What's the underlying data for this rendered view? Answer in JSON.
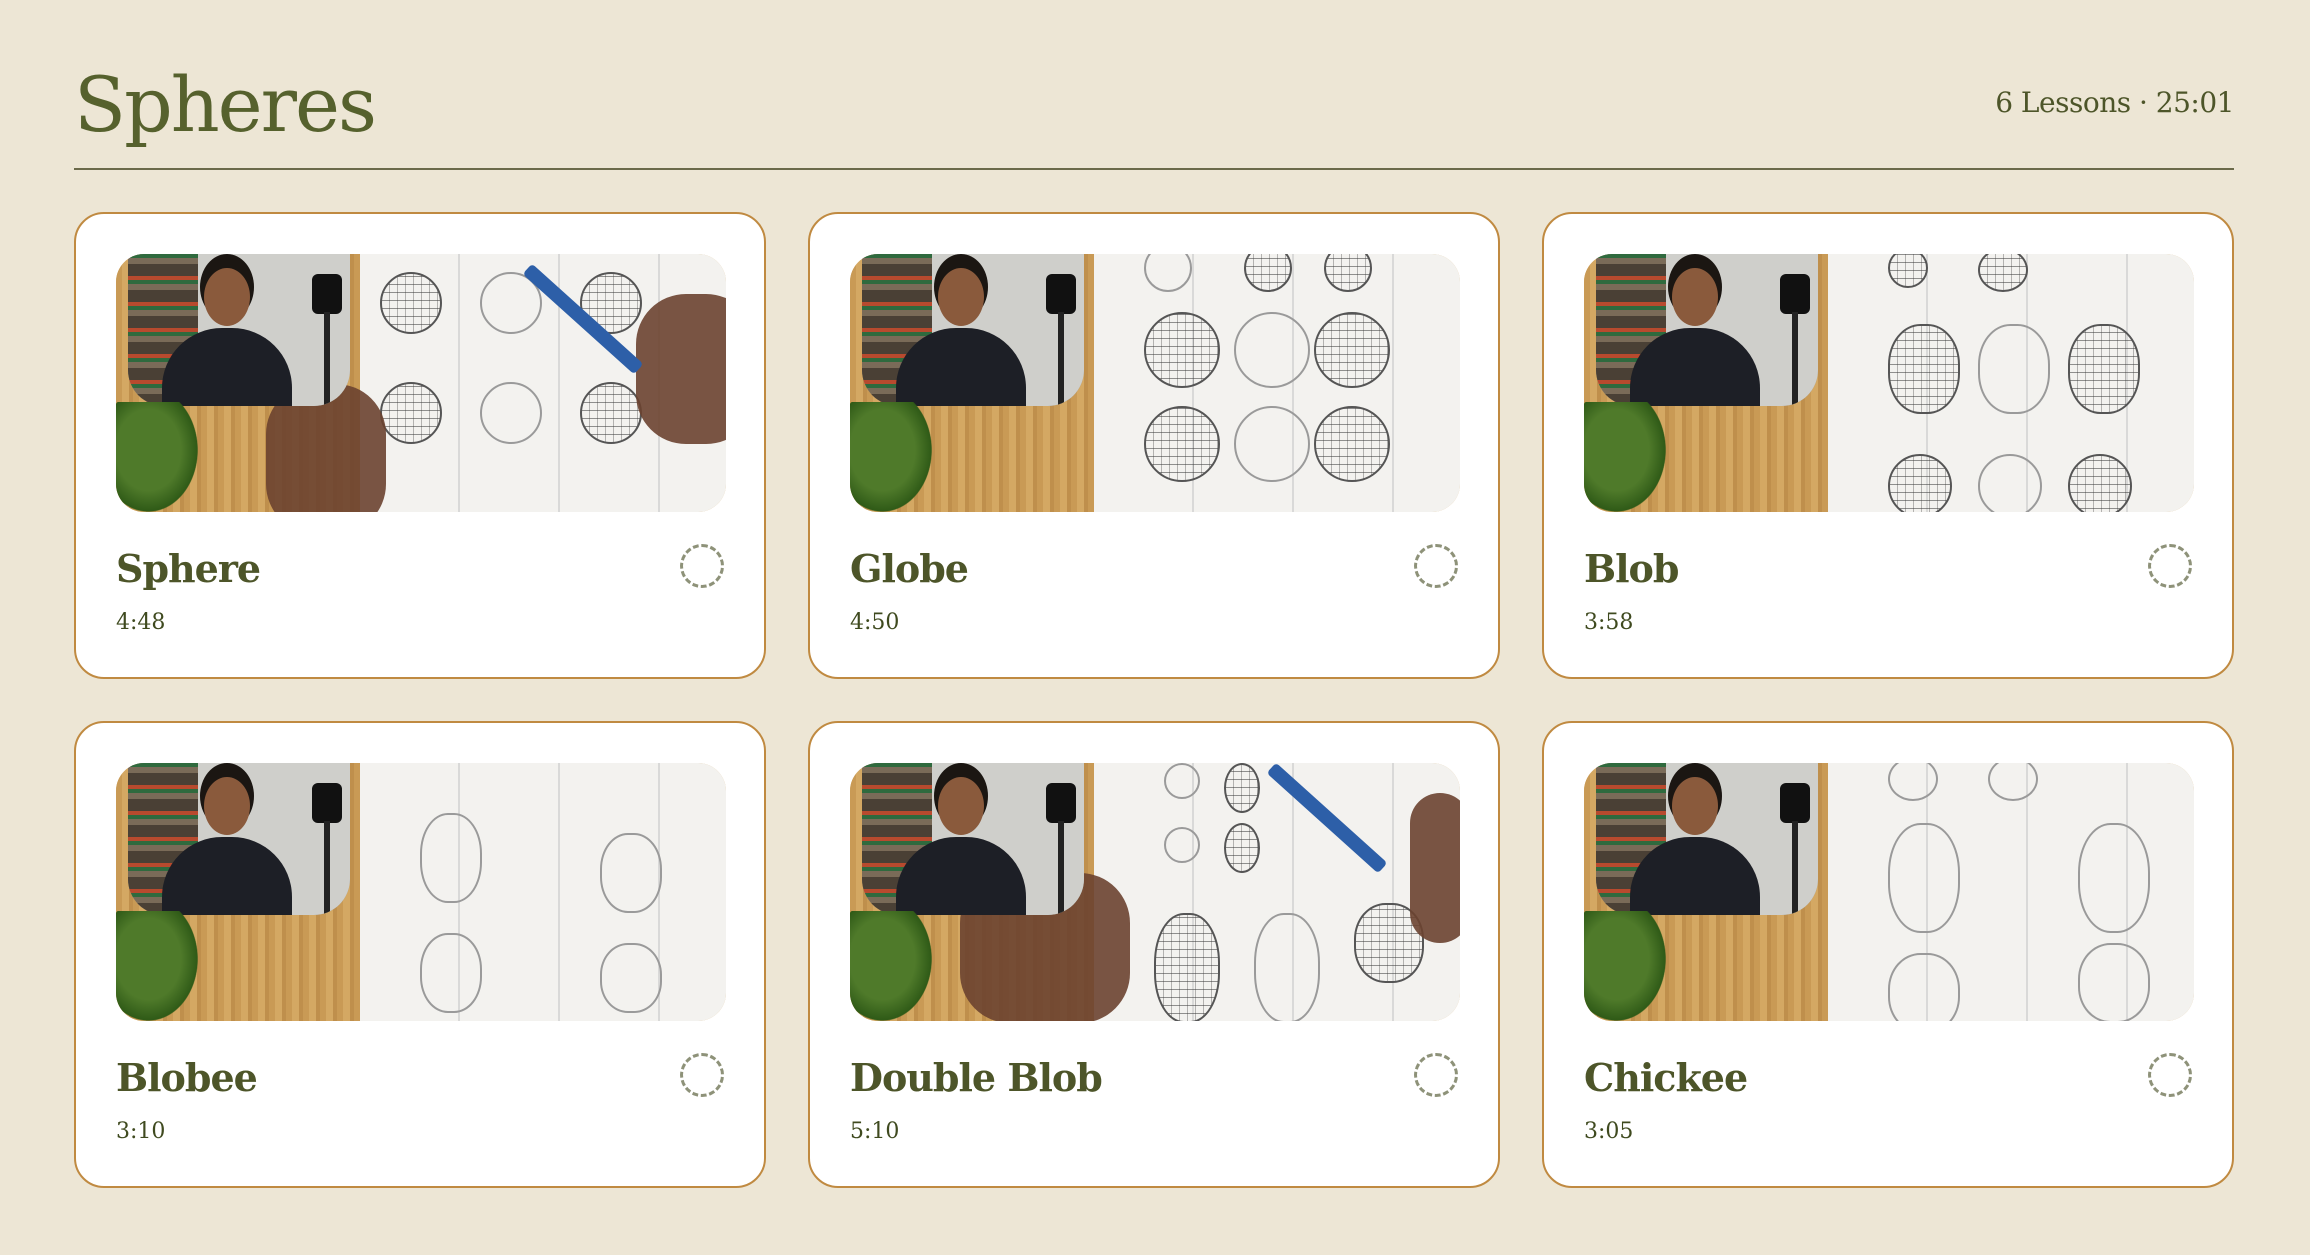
{
  "header": {
    "title": "Spheres",
    "meta": "6 Lessons · 25:01"
  },
  "lessons": [
    {
      "title": "Sphere",
      "duration": "4:48",
      "status_icon": "progress-circle-icon"
    },
    {
      "title": "Globe",
      "duration": "4:50",
      "status_icon": "progress-circle-icon"
    },
    {
      "title": "Blob",
      "duration": "3:58",
      "status_icon": "progress-circle-icon"
    },
    {
      "title": "Blobee",
      "duration": "3:10",
      "status_icon": "progress-circle-icon"
    },
    {
      "title": "Double Blob",
      "duration": "5:10",
      "status_icon": "progress-circle-icon"
    },
    {
      "title": "Chickee",
      "duration": "3:05",
      "status_icon": "progress-circle-icon"
    }
  ],
  "colors": {
    "background": "#ede6d5",
    "card_border": "#c08a41",
    "title_text": "#56612d"
  }
}
